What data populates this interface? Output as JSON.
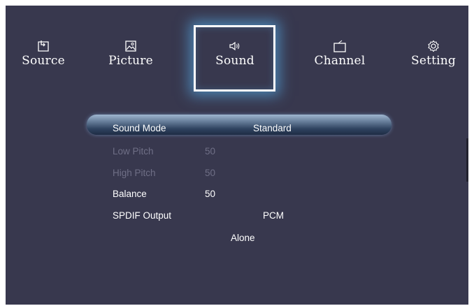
{
  "nav": {
    "items": [
      {
        "label": "Source",
        "icon": "source-input-icon"
      },
      {
        "label": "Picture",
        "icon": "picture-icon"
      },
      {
        "label": "Sound",
        "icon": "speaker-icon"
      },
      {
        "label": "Channel",
        "icon": "tv-icon"
      },
      {
        "label": "Setting",
        "icon": "gear-icon"
      }
    ],
    "selected": "Sound"
  },
  "menu": {
    "sound_mode": {
      "label": "Sound Mode",
      "value": "Standard"
    },
    "low_pitch": {
      "label": "Low Pitch",
      "value": "50"
    },
    "high_pitch": {
      "label": "High Pitch",
      "value": "50"
    },
    "balance": {
      "label": "Balance",
      "value": "50"
    },
    "spdif_output": {
      "label": "SPDIF Output",
      "value": "PCM"
    },
    "alone": {
      "label": "Alone"
    }
  },
  "colors": {
    "background": "#38384e",
    "highlight_border": "#ffffff",
    "glow": "#5abeff",
    "disabled_text": "#6f6f86"
  }
}
